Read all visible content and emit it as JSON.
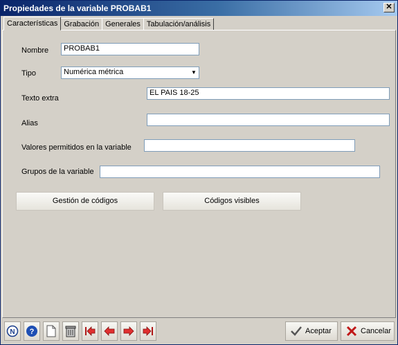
{
  "window": {
    "title": "Propiedades de la variable PROBAB1",
    "close_glyph": "✕"
  },
  "tabs": [
    {
      "label": "Características",
      "active": true
    },
    {
      "label": "Grabación",
      "active": false
    },
    {
      "label": "Generales",
      "active": false
    },
    {
      "label": "Tabulación/análisis",
      "active": false
    }
  ],
  "form": {
    "nombre": {
      "label": "Nombre",
      "value": "PROBAB1"
    },
    "tipo": {
      "label": "Tipo",
      "value": "Numérica métrica"
    },
    "texto_extra": {
      "label": "Texto extra",
      "value": "EL PAIS 18-25"
    },
    "alias": {
      "label": "Alias",
      "value": ""
    },
    "valores": {
      "label": "Valores permitidos en la variable",
      "value": ""
    },
    "grupos": {
      "label": "Grupos de la variable",
      "value": ""
    }
  },
  "buttons": {
    "gestion_codigos": "Gestión de códigos",
    "codigos_visibles": "Códigos visibles"
  },
  "toolbar": {
    "icons": [
      "n-circle-icon",
      "help-icon",
      "new-document-icon",
      "trash-icon",
      "first-record-icon",
      "previous-record-icon",
      "next-record-icon",
      "last-record-icon"
    ],
    "accept_label": "Aceptar",
    "cancel_label": "Cancelar"
  }
}
